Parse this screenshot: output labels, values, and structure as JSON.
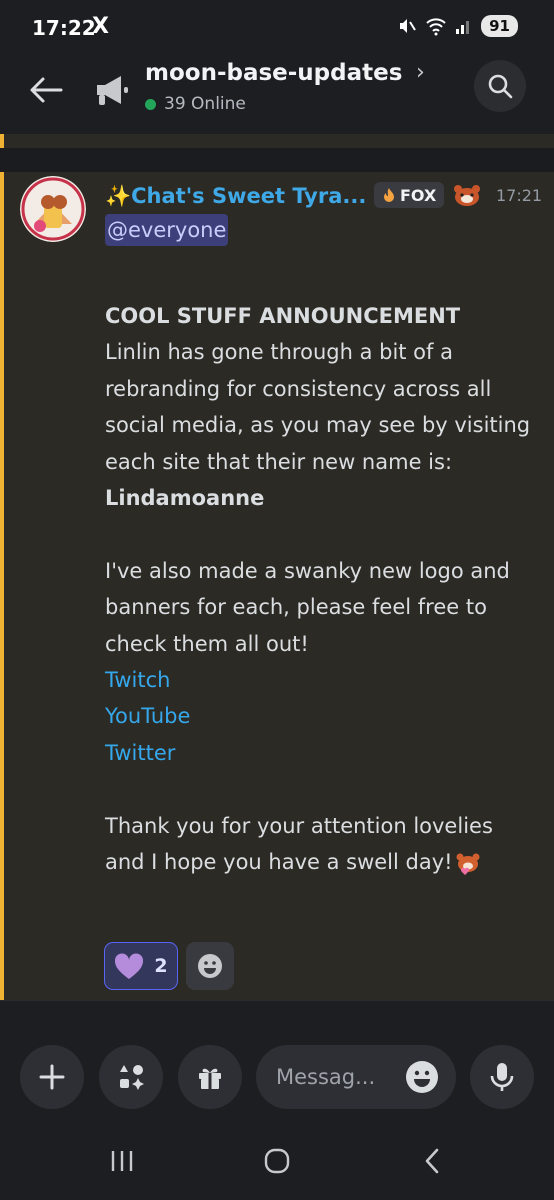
{
  "status_bar": {
    "time": "17:22",
    "x_logo": "X",
    "battery": "91",
    "icons": [
      "mute-icon",
      "wifi-icon",
      "signal-icon"
    ]
  },
  "header": {
    "channel_name": "moon-base-updates",
    "online_count": "39 Online",
    "icons": [
      "back-arrow-icon",
      "megaphone-icon",
      "chevron-right-icon",
      "search-icon"
    ]
  },
  "message": {
    "author": "✨Chat's Sweet Tyra...",
    "tag_label": "FOX",
    "timestamp": "17:21",
    "mention": "@everyone",
    "heading": "COOL STUFF ANNOUNCEMENT",
    "paragraph1": "Linlin has gone through a bit of a rebranding for consistency across all social media, as you may see by visiting each site that their new name is:",
    "new_name": "Lindamoanne",
    "paragraph2": "I've also made a swanky new logo and banners for each, please feel free to check them all out!",
    "links": [
      "Twitch",
      "YouTube",
      "Twitter"
    ],
    "closing": "Thank you for your attention lovelies and I hope you have a swell day!"
  },
  "reactions": [
    {
      "emoji": "purple-heart",
      "count": "2"
    }
  ],
  "composer": {
    "placeholder": "Messag...",
    "icons": [
      "plus-icon",
      "apps-icon",
      "gift-icon",
      "emoji-icon",
      "microphone-icon"
    ]
  },
  "colors": {
    "accent_bar": "#f0b232",
    "link": "#35a7eb",
    "author": "#3fa9e8",
    "online": "#23a55a"
  }
}
